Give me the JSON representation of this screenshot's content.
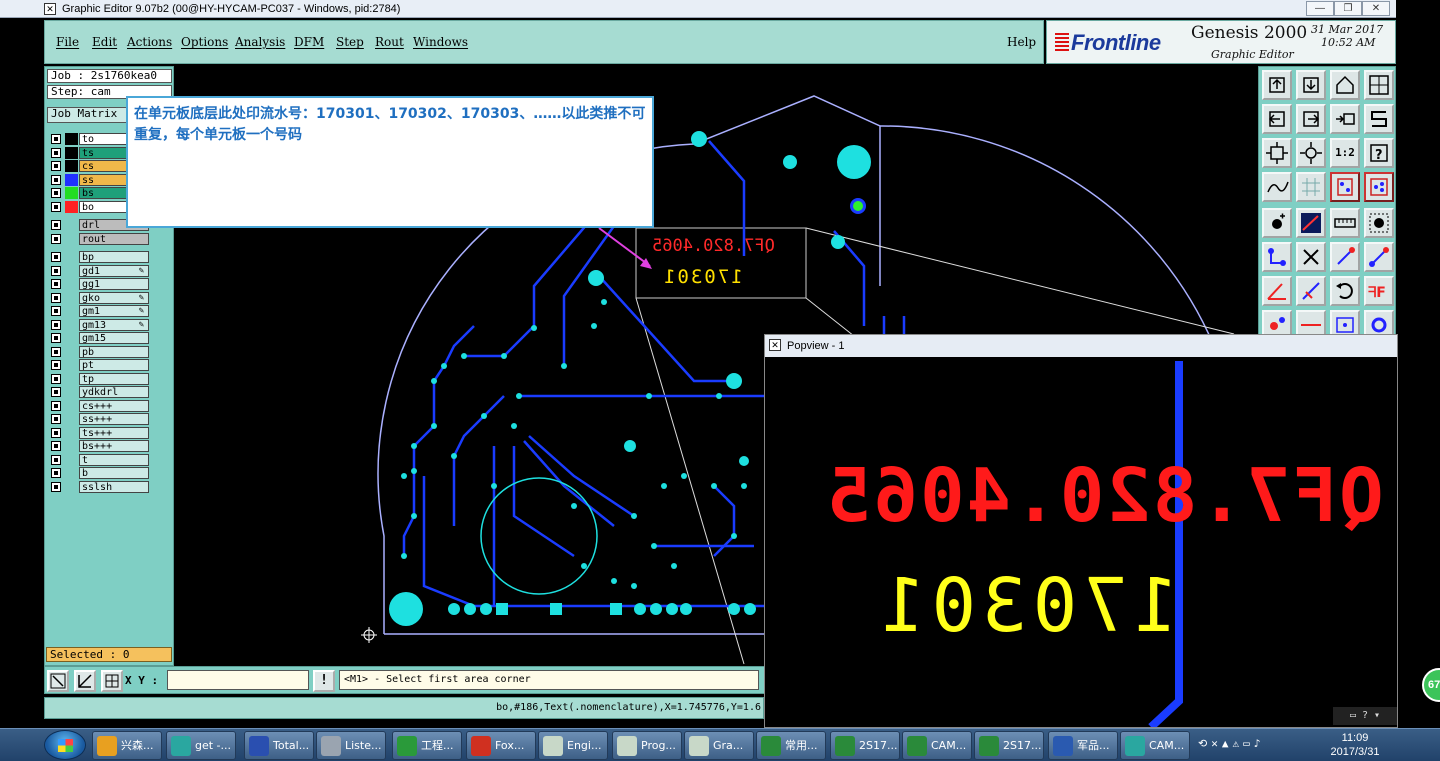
{
  "window": {
    "title": "Graphic Editor 9.07b2 (00@HY-HYCAM-PC037 - Windows, pid:2784)",
    "controls": [
      "—",
      "❐",
      "✕"
    ]
  },
  "menu": [
    "File",
    "Edit",
    "Actions",
    "Options",
    "Analysis",
    "DFM",
    "Step",
    "Rout",
    "Windows"
  ],
  "help_label": "Help",
  "branding": {
    "brand": "Frontline",
    "product": "Genesis 2000",
    "subtitle": "Graphic Editor",
    "date": "31 Mar 2017",
    "time": "10:52 AM"
  },
  "job": {
    "job_label": "Job : 2s1760kea0",
    "step_label": "Step: cam",
    "matrix_label": "Job Matrix"
  },
  "layers": [
    {
      "name": "to",
      "color": "#ffffff",
      "edit": ""
    },
    {
      "name": "ts",
      "color": "#1fa07a",
      "edit": ""
    },
    {
      "name": "cs",
      "color": "#f0b84a",
      "edit": ""
    },
    {
      "name": "ss",
      "color": "#f0b84a",
      "edit": ""
    },
    {
      "name": "bs",
      "color": "#1fa07a",
      "edit": ""
    },
    {
      "name": "bo",
      "color": "#ffffff",
      "edit": ""
    },
    {
      "name": "drl",
      "color": "#bcbcbc",
      "edit": ""
    },
    {
      "name": "rout",
      "color": "#bcbcbc",
      "edit": ""
    },
    {
      "name": "bp",
      "color": "#cdeae6",
      "edit": ""
    },
    {
      "name": "gd1",
      "color": "#cdeae6",
      "edit": "✎"
    },
    {
      "name": "gg1",
      "color": "#cdeae6",
      "edit": ""
    },
    {
      "name": "gko",
      "color": "#cdeae6",
      "edit": "✎"
    },
    {
      "name": "gm1",
      "color": "#cdeae6",
      "edit": "✎"
    },
    {
      "name": "gm13",
      "color": "#cdeae6",
      "edit": "✎"
    },
    {
      "name": "gm15",
      "color": "#cdeae6",
      "edit": ""
    },
    {
      "name": "pb",
      "color": "#cdeae6",
      "edit": ""
    },
    {
      "name": "pt",
      "color": "#cdeae6",
      "edit": ""
    },
    {
      "name": "tp",
      "color": "#cdeae6",
      "edit": ""
    },
    {
      "name": "ydkdrl",
      "color": "#cdeae6",
      "edit": ""
    },
    {
      "name": "cs+++",
      "color": "#cdeae6",
      "edit": ""
    },
    {
      "name": "ss+++",
      "color": "#cdeae6",
      "edit": ""
    },
    {
      "name": "ts+++",
      "color": "#cdeae6",
      "edit": ""
    },
    {
      "name": "bs+++",
      "color": "#cdeae6",
      "edit": ""
    },
    {
      "name": "t",
      "color": "#cdeae6",
      "edit": ""
    },
    {
      "name": "b",
      "color": "#cdeae6",
      "edit": ""
    },
    {
      "name": "sslsh",
      "color": "#cdeae6",
      "edit": ""
    }
  ],
  "selected_label": "Selected : 0",
  "note": {
    "text": "在单元板底层此处印流水号：170301、170302、170303、……以此类推不可重复，每个单元板一个号码"
  },
  "canvas_text": {
    "part_number": "QF7.820.4065",
    "serial": "170301"
  },
  "command": {
    "xy_label": "X Y :",
    "xy_value": "",
    "prompt": "<M1> - Select first area corner"
  },
  "status_line": "bo,#186,Text(.nomenclature),X=1.745776,Y=1.6",
  "popview": {
    "title": "Popview - 1",
    "part_number": "QF7.820.4065",
    "serial": "170301"
  },
  "taskbar": {
    "items": [
      {
        "label": "兴森...",
        "color": "#e8a020"
      },
      {
        "label": "get -...",
        "color": "#2aa7a0"
      },
      {
        "label": "Total...",
        "color": "#2a4fb0"
      },
      {
        "label": "Liste...",
        "color": "#9aa4b0"
      },
      {
        "label": "工程...",
        "color": "#2a9a3a"
      },
      {
        "label": "Fox...",
        "color": "#d03020"
      },
      {
        "label": "Engi...",
        "color": "#c8d8c8"
      },
      {
        "label": "Prog...",
        "color": "#c8d8c8"
      },
      {
        "label": "Gra...",
        "color": "#c8d8c8"
      },
      {
        "label": "常用...",
        "color": "#2a8a3a"
      },
      {
        "label": "2S17...",
        "color": "#2a8a3a"
      },
      {
        "label": "CAM...",
        "color": "#2a8a3a"
      },
      {
        "label": "2S17...",
        "color": "#2a8a3a"
      },
      {
        "label": "军品...",
        "color": "#2a5ab0"
      },
      {
        "label": "CAM...",
        "color": "#2aa7a0"
      }
    ],
    "clock_time": "11:09",
    "clock_date": "2017/3/31",
    "badge": "67"
  }
}
